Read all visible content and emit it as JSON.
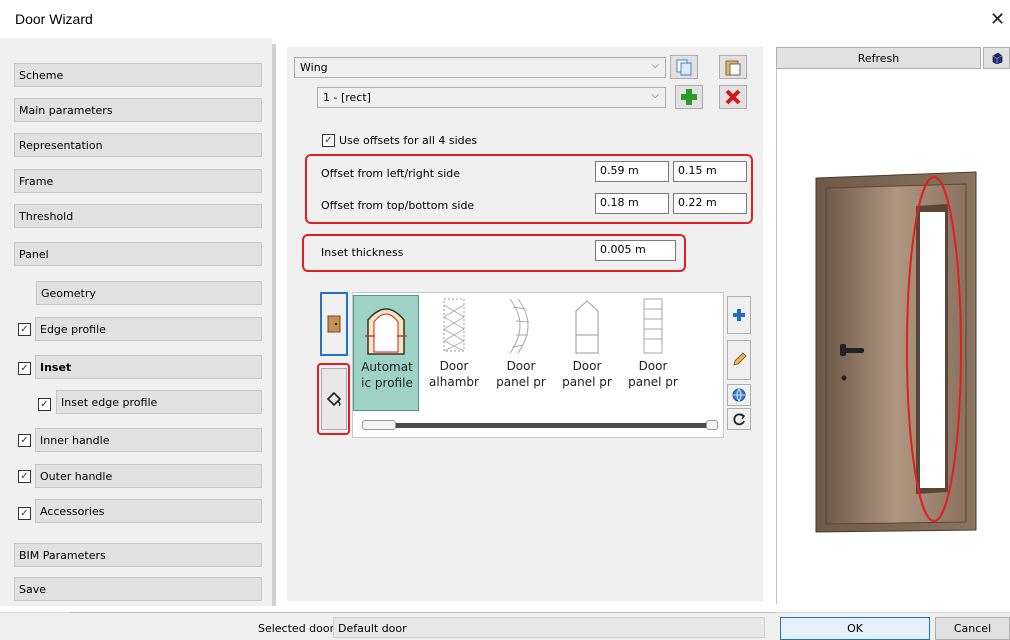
{
  "window": {
    "title": "Door Wizard",
    "close_glyph": "✕"
  },
  "sidebar": {
    "items": [
      {
        "label": "Scheme"
      },
      {
        "label": "Main parameters"
      },
      {
        "label": "Representation"
      },
      {
        "label": "Frame"
      },
      {
        "label": "Threshold"
      },
      {
        "label": "Panel"
      },
      {
        "label": "Geometry"
      },
      {
        "label": "Edge profile",
        "checked": true
      },
      {
        "label": "Inset",
        "checked": true
      },
      {
        "label": "Inset edge profile",
        "checked": true
      },
      {
        "label": "Inner handle",
        "checked": true
      },
      {
        "label": "Outer handle",
        "checked": true
      },
      {
        "label": "Accessories",
        "checked": true
      },
      {
        "label": "BIM Parameters"
      },
      {
        "label": "Save"
      }
    ],
    "check_glyph": "✓"
  },
  "main": {
    "wing_select": "Wing",
    "item_select": "1 - [rect]",
    "use_offsets_label": "Use offsets for all 4 sides",
    "use_offsets_checked": true,
    "offset_lr_label": "Offset from left/right side",
    "offset_lr_values": [
      "0.59 m",
      "0.15 m"
    ],
    "offset_tb_label": "Offset from top/bottom side",
    "offset_tb_values": [
      "0.18 m",
      "0.22 m"
    ],
    "inset_label": "Inset thickness",
    "inset_value": "0.005 m",
    "gallery": [
      {
        "line1": "Automat",
        "line2": "ic profile",
        "selected": true
      },
      {
        "line1": "Door",
        "line2": "alhambr"
      },
      {
        "line1": "Door",
        "line2": "panel pr"
      },
      {
        "line1": "Door",
        "line2": "panel pr"
      },
      {
        "line1": "Door",
        "line2": "panel pr"
      }
    ]
  },
  "preview": {
    "refresh_label": "Refresh"
  },
  "footer": {
    "selected_door_label": "Selected door",
    "selected_door_value": "Default door",
    "ok_label": "OK",
    "cancel_label": "Cancel"
  },
  "icons": [
    "copy-icon",
    "paste-icon",
    "add-icon",
    "delete-icon",
    "door-icon",
    "paint-bucket-icon",
    "plus-icon",
    "pencil-icon",
    "globe-icon",
    "refresh-icon",
    "cube-icon",
    "chevron-down-icon"
  ],
  "colors": {
    "highlight": "#e02020",
    "selected_tile": "#9ed2c4",
    "blue_button_border": "#1f74c9"
  }
}
